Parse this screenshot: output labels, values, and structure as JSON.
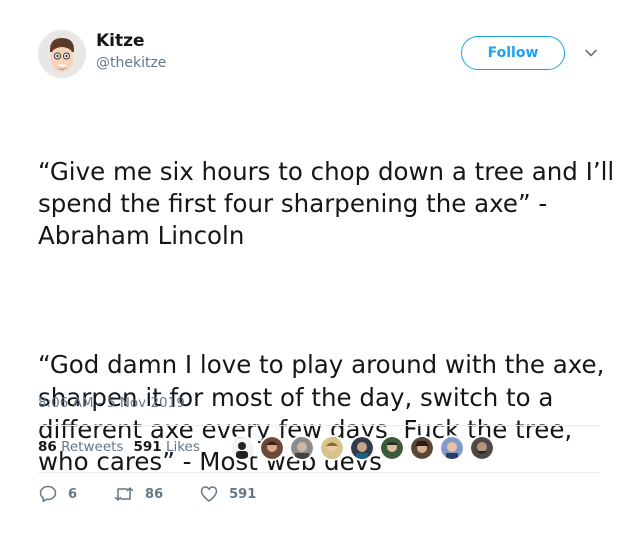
{
  "author": {
    "name": "Kitze",
    "handle": "@thekitze"
  },
  "follow_label": "Follow",
  "tweet": {
    "paragraphs": [
      "“Give me six hours to chop down a tree and I’ll spend the first four sharpening the axe” - Abraham Lincoln",
      "“God damn I love to play around with the axe, sharpen it for most of the day, switch to a different axe every few days. Fuck the tree, who cares” - Most web devs"
    ],
    "timestamp": "8:06 AM - 5 Nov 2019"
  },
  "stats": {
    "retweets_count": "86",
    "retweets_label": "Retweets",
    "likes_count": "591",
    "likes_label": "Likes"
  },
  "actions": {
    "reply_count": "6",
    "retweet_count": "86",
    "like_count": "591"
  },
  "colors": {
    "accent": "#1da1f2",
    "muted": "#657786",
    "divider": "#e6ecf0"
  }
}
